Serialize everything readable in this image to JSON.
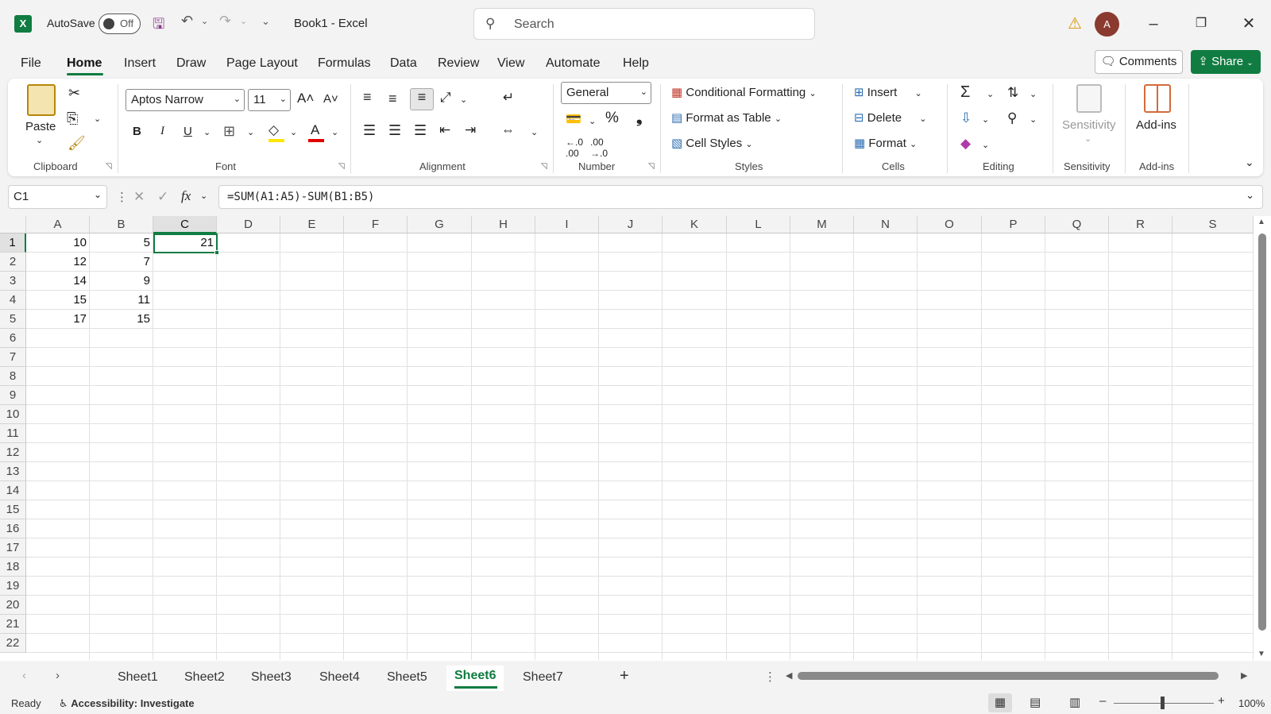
{
  "app": {
    "title": "Book1  -  Excel",
    "logo_letter": "X",
    "autosave_label": "AutoSave",
    "autosave_state": "Off"
  },
  "search": {
    "placeholder": "Search"
  },
  "user": {
    "initial": "A"
  },
  "tabs": [
    "File",
    "Home",
    "Insert",
    "Draw",
    "Page Layout",
    "Formulas",
    "Data",
    "Review",
    "View",
    "Automate",
    "Help"
  ],
  "active_tab": "Home",
  "header_buttons": {
    "comments": "Comments",
    "share": "Share"
  },
  "ribbon": {
    "clipboard": {
      "label": "Clipboard",
      "paste": "Paste"
    },
    "font": {
      "label": "Font",
      "font_name": "Aptos Narrow",
      "font_size": "11",
      "bold": "B",
      "italic": "I",
      "underline": "U"
    },
    "alignment": {
      "label": "Alignment"
    },
    "number": {
      "label": "Number",
      "format": "General"
    },
    "styles": {
      "label": "Styles",
      "conditional": "Conditional Formatting",
      "format_table": "Format as Table",
      "cell_styles": "Cell Styles"
    },
    "cells": {
      "label": "Cells",
      "insert": "Insert",
      "delete": "Delete",
      "format": "Format"
    },
    "editing": {
      "label": "Editing"
    },
    "sensitivity": {
      "label": "Sensitivity",
      "button": "Sensitivity"
    },
    "addins": {
      "label": "Add-ins",
      "button": "Add-ins"
    }
  },
  "formula_bar": {
    "name_box": "C1",
    "formula": "=SUM(A1:A5)-SUM(B1:B5)",
    "fx": "fx"
  },
  "columns": [
    "A",
    "B",
    "C",
    "D",
    "E",
    "F",
    "G",
    "H",
    "I",
    "J",
    "K",
    "L",
    "M",
    "N",
    "O",
    "P",
    "Q",
    "R",
    "S"
  ],
  "rows": [
    "1",
    "2",
    "3",
    "4",
    "5",
    "6",
    "7",
    "8",
    "9",
    "10",
    "11",
    "12",
    "13",
    "14",
    "15",
    "16",
    "17",
    "18",
    "19",
    "20",
    "21",
    "22"
  ],
  "cells": {
    "A1": "10",
    "B1": "5",
    "C1": "21",
    "A2": "12",
    "B2": "7",
    "A3": "14",
    "B3": "9",
    "A4": "15",
    "B4": "11",
    "A5": "17",
    "B5": "15"
  },
  "selected_cell": "C1",
  "sheets": [
    "Sheet1",
    "Sheet2",
    "Sheet3",
    "Sheet4",
    "Sheet5",
    "Sheet6",
    "Sheet7"
  ],
  "active_sheet": "Sheet6",
  "status": {
    "ready": "Ready",
    "accessibility": "Accessibility: Investigate",
    "zoom": "100%"
  },
  "colors": {
    "accent": "#107c41",
    "warning": "#d99300",
    "avatar": "#8b3a2f"
  }
}
